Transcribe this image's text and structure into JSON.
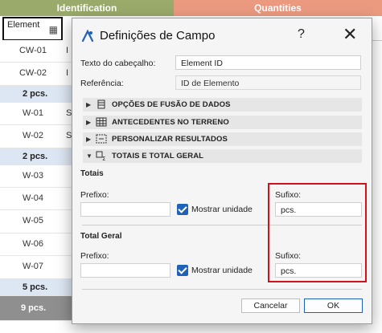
{
  "schedule": {
    "group_identification": "Identification",
    "group_quantities": "Quantities",
    "element_header": "Element",
    "rows": [
      {
        "id": "CW-01",
        "extra": "I"
      },
      {
        "id": "CW-02",
        "extra": "I"
      },
      {
        "subtotal": "2 pcs."
      },
      {
        "id": "W-01",
        "extra": "S"
      },
      {
        "id": "W-02",
        "extra": "S"
      },
      {
        "subtotal": "2 pcs."
      },
      {
        "id": "W-03",
        "extra": ""
      },
      {
        "id": "W-04",
        "extra": ""
      },
      {
        "id": "W-05",
        "extra": ""
      },
      {
        "id": "W-06",
        "extra": ""
      },
      {
        "id": "W-07",
        "extra": ""
      },
      {
        "subtotal": "5 pcs."
      },
      {
        "total": "9 pcs."
      }
    ]
  },
  "dialog": {
    "title": "Definições de Campo",
    "help_label": "?",
    "close_label": "✕",
    "header_text_label": "Texto do cabeçalho:",
    "header_text_value": "Element ID",
    "reference_label": "Referência:",
    "reference_value": "ID de Elemento",
    "sections": [
      {
        "label": "OPÇÕES DE FUSÃO DE DADOS",
        "icon": "merge-options-icon",
        "expanded": false
      },
      {
        "label": "ANTECEDENTES NO TERRENO",
        "icon": "table-grid-icon",
        "expanded": false
      },
      {
        "label": "PERSONALIZAR RESULTADOS",
        "icon": "customize-results-icon",
        "expanded": false
      },
      {
        "label": "TOTAIS E TOTAL GERAL",
        "icon": "sum-icon",
        "expanded": true
      }
    ],
    "totals": {
      "group_label": "Totais",
      "prefix_label": "Prefixo:",
      "prefix_value": "",
      "show_unit_label": "Mostrar unidade",
      "suffix_label": "Sufixo:",
      "suffix_value": "pcs."
    },
    "grand_total": {
      "group_label": "Total Geral",
      "prefix_label": "Prefixo:",
      "prefix_value": "",
      "show_unit_label": "Mostrar unidade",
      "suffix_label": "Sufixo:",
      "suffix_value": "pcs."
    },
    "cancel_label": "Cancelar",
    "ok_label": "OK"
  },
  "colors": {
    "identification": "#9aaa6a",
    "quantities": "#eb9a80",
    "subtotal_row": "#dde6f3",
    "total_row": "#8f8f8f",
    "checkbox": "#1f63b8",
    "highlight": "#d0121b"
  }
}
